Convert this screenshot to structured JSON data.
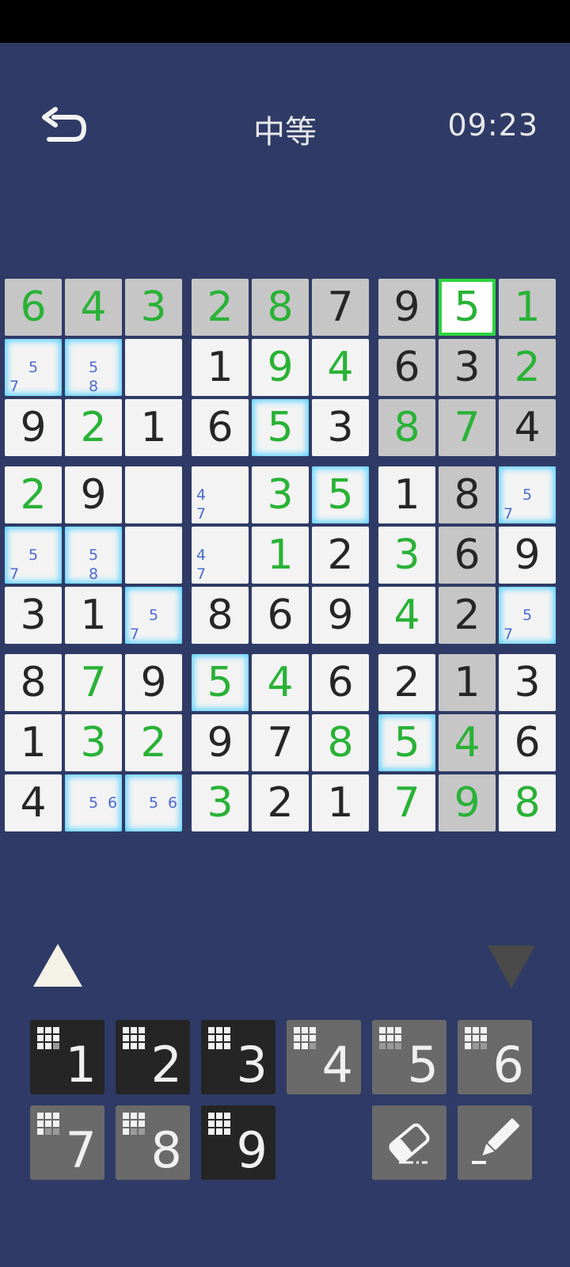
{
  "header": {
    "title": "中等",
    "timer": "09:23"
  },
  "colors": {
    "background": "#2f3b66",
    "user_digit": "#29b236",
    "given_digit": "#262626",
    "note_digit": "#4b6bd0",
    "glow": "#5fd3ff",
    "selected_border": "#2ed43f"
  },
  "board": [
    [
      {
        "v": "6",
        "t": "user",
        "h": "gray"
      },
      {
        "v": "4",
        "t": "user",
        "h": "gray"
      },
      {
        "v": "3",
        "t": "user",
        "h": "gray"
      },
      {
        "v": "2",
        "t": "user",
        "h": "gray"
      },
      {
        "v": "8",
        "t": "user",
        "h": "gray"
      },
      {
        "v": "7",
        "t": "given",
        "h": "gray"
      },
      {
        "v": "9",
        "t": "given",
        "h": "gray"
      },
      {
        "v": "5",
        "t": "user",
        "h": "selected"
      },
      {
        "v": "1",
        "t": "user",
        "h": "gray"
      }
    ],
    [
      {
        "notes": {
          "5": "5",
          "7": "7"
        },
        "h": "glow"
      },
      {
        "notes": {
          "5": "5",
          "8": "8"
        },
        "h": "glow"
      },
      {
        "v": ""
      },
      {
        "v": "1",
        "t": "given"
      },
      {
        "v": "9",
        "t": "user"
      },
      {
        "v": "4",
        "t": "user"
      },
      {
        "v": "6",
        "t": "given",
        "h": "gray"
      },
      {
        "v": "3",
        "t": "given",
        "h": "gray"
      },
      {
        "v": "2",
        "t": "user",
        "h": "gray"
      }
    ],
    [
      {
        "v": "9",
        "t": "given"
      },
      {
        "v": "2",
        "t": "user"
      },
      {
        "v": "1",
        "t": "given"
      },
      {
        "v": "6",
        "t": "given"
      },
      {
        "v": "5",
        "t": "user",
        "h": "glow"
      },
      {
        "v": "3",
        "t": "given"
      },
      {
        "v": "8",
        "t": "user",
        "h": "gray"
      },
      {
        "v": "7",
        "t": "user",
        "h": "gray"
      },
      {
        "v": "4",
        "t": "given",
        "h": "gray"
      }
    ],
    [
      {
        "v": "2",
        "t": "user"
      },
      {
        "v": "9",
        "t": "given"
      },
      {
        "v": ""
      },
      {
        "notes": {
          "4": "4",
          "7": "7"
        }
      },
      {
        "v": "3",
        "t": "user"
      },
      {
        "v": "5",
        "t": "user",
        "h": "glow"
      },
      {
        "v": "1",
        "t": "given"
      },
      {
        "v": "8",
        "t": "given",
        "h": "gray"
      },
      {
        "notes": {
          "5": "5",
          "7": "7"
        },
        "h": "glow"
      }
    ],
    [
      {
        "notes": {
          "5": "5",
          "7": "7"
        },
        "h": "glow"
      },
      {
        "notes": {
          "5": "5",
          "8": "8"
        },
        "h": "glow"
      },
      {
        "v": ""
      },
      {
        "notes": {
          "4": "4",
          "7": "7"
        }
      },
      {
        "v": "1",
        "t": "user"
      },
      {
        "v": "2",
        "t": "given"
      },
      {
        "v": "3",
        "t": "user"
      },
      {
        "v": "6",
        "t": "given",
        "h": "gray"
      },
      {
        "v": "9",
        "t": "given"
      }
    ],
    [
      {
        "v": "3",
        "t": "given"
      },
      {
        "v": "1",
        "t": "given"
      },
      {
        "notes": {
          "5": "5",
          "7": "7"
        },
        "h": "glow"
      },
      {
        "v": "8",
        "t": "given"
      },
      {
        "v": "6",
        "t": "given"
      },
      {
        "v": "9",
        "t": "given"
      },
      {
        "v": "4",
        "t": "user"
      },
      {
        "v": "2",
        "t": "given",
        "h": "gray"
      },
      {
        "notes": {
          "5": "5",
          "7": "7"
        },
        "h": "glow"
      }
    ],
    [
      {
        "v": "8",
        "t": "given"
      },
      {
        "v": "7",
        "t": "user"
      },
      {
        "v": "9",
        "t": "given"
      },
      {
        "v": "5",
        "t": "user",
        "h": "glow"
      },
      {
        "v": "4",
        "t": "user"
      },
      {
        "v": "6",
        "t": "given"
      },
      {
        "v": "2",
        "t": "given"
      },
      {
        "v": "1",
        "t": "given",
        "h": "gray"
      },
      {
        "v": "3",
        "t": "given"
      }
    ],
    [
      {
        "v": "1",
        "t": "given"
      },
      {
        "v": "3",
        "t": "user"
      },
      {
        "v": "2",
        "t": "user"
      },
      {
        "v": "9",
        "t": "given"
      },
      {
        "v": "7",
        "t": "given"
      },
      {
        "v": "8",
        "t": "user"
      },
      {
        "v": "5",
        "t": "user",
        "h": "glow"
      },
      {
        "v": "4",
        "t": "user",
        "h": "gray"
      },
      {
        "v": "6",
        "t": "given"
      }
    ],
    [
      {
        "v": "4",
        "t": "given"
      },
      {
        "notes": {
          "5": "5",
          "6": "6"
        },
        "h": "glow"
      },
      {
        "notes": {
          "5": "5",
          "6": "6"
        },
        "h": "glow"
      },
      {
        "v": "3",
        "t": "user"
      },
      {
        "v": "2",
        "t": "given"
      },
      {
        "v": "1",
        "t": "given"
      },
      {
        "v": "7",
        "t": "user"
      },
      {
        "v": "9",
        "t": "user",
        "h": "gray"
      },
      {
        "v": "8",
        "t": "user"
      }
    ]
  ],
  "keypad": {
    "digits": [
      {
        "label": "1",
        "style": "dark",
        "remaining": "8"
      },
      {
        "label": "2",
        "style": "dark",
        "remaining": "9"
      },
      {
        "label": "3",
        "style": "dark",
        "remaining": "9"
      },
      {
        "label": "4",
        "style": "light",
        "remaining": "8"
      },
      {
        "label": "5",
        "style": "light",
        "remaining": "6"
      },
      {
        "label": "6",
        "style": "light",
        "remaining": "7"
      },
      {
        "label": "7",
        "style": "light",
        "remaining": "7"
      },
      {
        "label": "8",
        "style": "light",
        "remaining": "7"
      },
      {
        "label": "9",
        "style": "dark",
        "remaining": "9"
      }
    ],
    "tools": [
      {
        "icon": "eraser-icon"
      },
      {
        "icon": "pencil-icon"
      }
    ]
  }
}
